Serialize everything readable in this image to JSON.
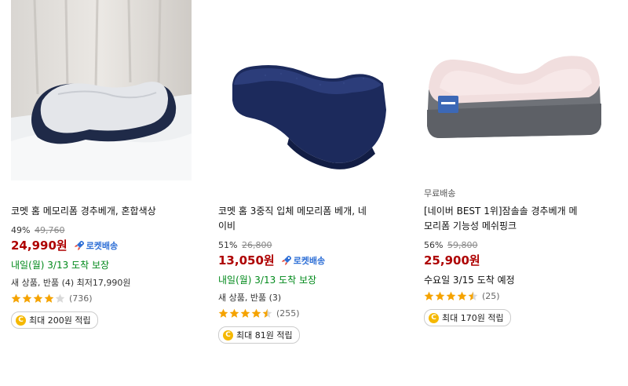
{
  "products": [
    {
      "tag": "",
      "title_lines": [
        "코멧 홈 메모리폼 경추베개, 혼합색상"
      ],
      "discount_rate": "49%",
      "original_price": "49,760",
      "price": "24,990원",
      "rocket_label": "로켓배송",
      "delivery": "내일(월) 3/13 도착 보장",
      "variants": "새 상품, 반품 (4) 최저17,990원",
      "rating": 4.0,
      "review_count": "(736)",
      "reward": "최대 200원 적립",
      "image": "white-gray-memory-foam-pillow-on-bed"
    },
    {
      "tag": "",
      "title_lines": [
        "코멧 홈 3중직 입체 메모리폼 베개, 네",
        "이비"
      ],
      "discount_rate": "51%",
      "original_price": "26,800",
      "price": "13,050원",
      "rocket_label": "로켓배송",
      "delivery": "내일(월) 3/13 도착 보장",
      "variants": "새 상품, 반품 (3)",
      "rating": 4.5,
      "review_count": "(255)",
      "reward": "최대 81원 적립",
      "image": "navy-mesh-contour-pillow"
    },
    {
      "tag": "무료배송",
      "title_lines": [
        "[네이버 BEST 1위]잠솔솔 경추베개 메",
        "모리폼 기능성 메쉬핑크"
      ],
      "discount_rate": "56%",
      "original_price": "59,800",
      "price": "25,900원",
      "rocket_label": "",
      "delivery": "수요일 3/15 도착 예정",
      "variants": "",
      "rating": 4.5,
      "review_count": "(25)",
      "reward": "최대 170원 적립",
      "image": "pink-gray-cervical-pillow"
    }
  ],
  "colors": {
    "price": "#ae0000",
    "rocket": "#2e6fd6",
    "delivery_guaranteed": "#00891a",
    "star": "#f5a300",
    "coin": "#f5b800"
  },
  "icons": {
    "rocket": "rocket-icon",
    "star": "star-icon",
    "coin": "coin-icon"
  },
  "coin_symbol": "C"
}
